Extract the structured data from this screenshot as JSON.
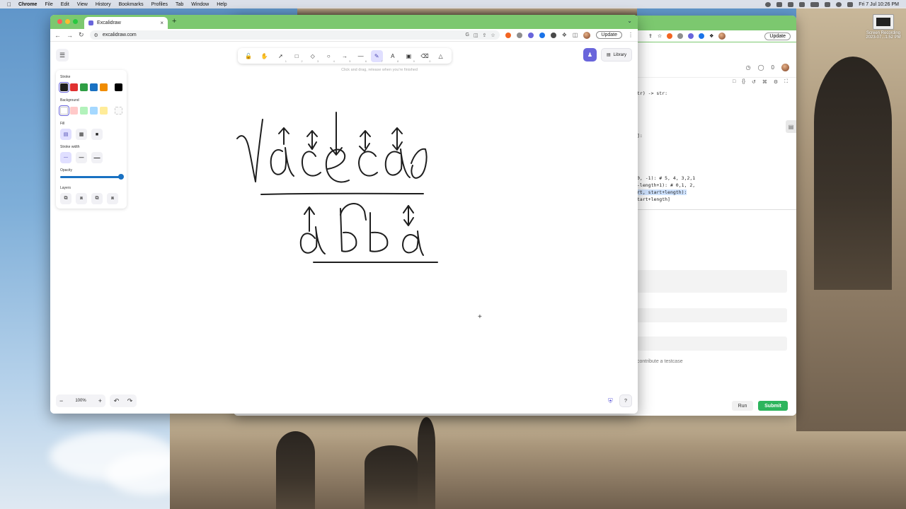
{
  "menubar": {
    "app": "Chrome",
    "items": [
      "File",
      "Edit",
      "View",
      "History",
      "Bookmarks",
      "Profiles",
      "Tab",
      "Window",
      "Help"
    ],
    "datetime": "Fri 7 Jul  10:26 PM"
  },
  "desktop": {
    "icon_label_1": "Screen Recording",
    "icon_label_2": "2023-07...1.52 PM"
  },
  "browser": {
    "tab_title": "Excalidraw",
    "url": "excalidraw.com",
    "update_label": "Update"
  },
  "excalidraw": {
    "hint": "Click and drag, release when you're finished",
    "library_label": "Library",
    "zoom_level": "100%",
    "accent": "#6965db",
    "props": {
      "stroke_label": "Stroke",
      "background_label": "Background",
      "fill_label": "Fill",
      "stroke_width_label": "Stroke width",
      "opacity_label": "Opacity",
      "layers_label": "Layers",
      "stroke_colors": [
        "#1e1e1e",
        "#e03131",
        "#2f9e44",
        "#1971c2",
        "#f08c00",
        "#000000"
      ],
      "background_colors": [
        "#ffffff",
        "#ffc9c9",
        "#b2f2bb",
        "#a5d8ff",
        "#ffec99"
      ],
      "opacity": 1.0
    },
    "tool_keys": [
      "",
      "",
      "1",
      "2",
      "3",
      "4",
      "5",
      "6",
      "7",
      "8",
      "9",
      "0",
      ""
    ]
  },
  "leetcode": {
    "update_label": "Update",
    "counter": "0",
    "code_lines": [
      "tr) -> str:",
      "]:",
      "0, -1): # 5, 4, 3,2,1",
      "-length+1): # 0,1, 2,",
      "rt, start+length):",
      "tart+length]"
    ],
    "contribute": "contribute a testcase",
    "run_label": "Run",
    "submit_label": "Submit",
    "submit_color": "#2db55d"
  }
}
